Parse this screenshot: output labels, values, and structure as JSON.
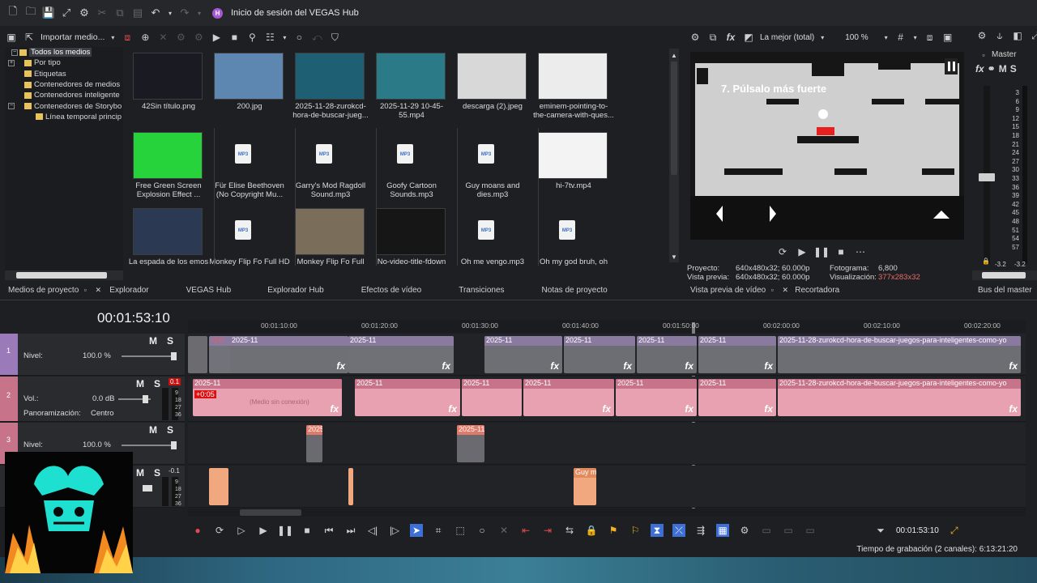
{
  "app": {
    "title": "Inicio de sesión del VEGAS Hub",
    "hub_badge": "H"
  },
  "media_toolbar": {
    "import_label": "Importar medio..."
  },
  "tree": {
    "items": [
      {
        "label": "Todos los medios",
        "selected": true
      },
      {
        "label": "Por tipo"
      },
      {
        "label": "Etiquetas"
      },
      {
        "label": "Contenedores de medios"
      },
      {
        "label": "Contenedores inteligente"
      },
      {
        "label": "Contenedores de Storybo"
      },
      {
        "label": "Línea temporal princip"
      }
    ]
  },
  "media": [
    {
      "label": "42Sin título.png",
      "kind": "image",
      "color": "#1a1a22"
    },
    {
      "label": "200.jpg",
      "kind": "image",
      "color": "#5d87b0"
    },
    {
      "label": "2025-11-28-zurokcd-hora-de-buscar-jueg...",
      "kind": "video",
      "color": "#1f5f73"
    },
    {
      "label": "2025-11-29 10-45-55.mp4",
      "kind": "video",
      "color": "#2a7a88"
    },
    {
      "label": "descarga (2).jpeg",
      "kind": "image",
      "color": "#d8d8d8"
    },
    {
      "label": "eminem-pointing-to-the-camera-with-ques...",
      "kind": "image",
      "color": "#ececec"
    },
    {
      "label": "Free Green Screen Explosion Effect ...",
      "kind": "image",
      "color": "#27d33a"
    },
    {
      "label": "Für Elise  Beethoven (No Copyright Mu...",
      "kind": "mp3"
    },
    {
      "label": "Garry's Mod Ragdoll Sound.mp3",
      "kind": "mp3"
    },
    {
      "label": "Goofy Cartoon Sounds.mp3",
      "kind": "mp3"
    },
    {
      "label": "Guy moans and dies.mp3",
      "kind": "mp3"
    },
    {
      "label": "hi-7tv.mp4",
      "kind": "image",
      "color": "#f3f3f3"
    },
    {
      "label": "La espada de los emos",
      "kind": "video",
      "color": "#2b3a52"
    },
    {
      "label": "Monkey Flip Fo Full HD",
      "kind": "mp3"
    },
    {
      "label": "Monkey Flip Fo Full",
      "kind": "image",
      "color": "#7a6e5a"
    },
    {
      "label": "No-video-title-fdown",
      "kind": "video",
      "color": "#161616"
    },
    {
      "label": "Oh me vengo.mp3",
      "kind": "mp3"
    },
    {
      "label": "Oh my god bruh, oh",
      "kind": "mp3"
    }
  ],
  "mp3_tag": "MP3",
  "tabs_left": [
    "Medios de proyecto",
    "Explorador",
    "VEGAS Hub",
    "Explorador Hub",
    "Efectos de vídeo",
    "Transiciones",
    "Notas de proyecto"
  ],
  "preview": {
    "quality": "La mejor (total)",
    "zoom": "100 %",
    "game_title": "7. Púlsalo más fuerte",
    "proyecto_label": "Proyecto:",
    "proyecto_value": "640x480x32; 60.000p",
    "vista_label": "Vista previa:",
    "vista_value": "640x480x32; 60.000p",
    "fotograma_label": "Fotograma:",
    "fotograma_value": "6,800",
    "visualizacion_label": "Visualización:",
    "visualizacion_value": "377x283x32",
    "tab_preview": "Vista previa de vídeo",
    "tab_trimmer": "Recortadora"
  },
  "master": {
    "label": "Master",
    "scale": [
      "3",
      "6",
      "9",
      "12",
      "15",
      "18",
      "21",
      "24",
      "27",
      "30",
      "33",
      "36",
      "39",
      "42",
      "45",
      "48",
      "51",
      "54",
      "57"
    ],
    "left_val": "-3.2",
    "right_val": "-3.2",
    "tab": "Bus del master"
  },
  "timeline": {
    "time": "00:01:53:10",
    "ruler": [
      "00:01:10:00",
      "00:01:20:00",
      "00:01:30:00",
      "00:01:40:00",
      "00:01:50:00",
      "00:02:00:00",
      "00:02:10:00",
      "00:02:20:00"
    ],
    "tracks": [
      {
        "num": "1",
        "type": "video",
        "level_label": "Nivel:",
        "level_value": "100.0 %",
        "m": "M",
        "s": "S"
      },
      {
        "num": "2",
        "type": "audio",
        "vol_label": "Vol.:",
        "vol_value": "0.0 dB",
        "pan_label": "Panoramización:",
        "pan_value": "Centro",
        "m": "M",
        "s": "S",
        "peak": "0.1"
      },
      {
        "num": "3",
        "type": "video",
        "level_label": "Nivel:",
        "level_value": "100.0 %",
        "m": "M",
        "s": "S"
      },
      {
        "num": "4",
        "type": "audio",
        "m": "M",
        "s": "S",
        "peak": "-0.1"
      }
    ],
    "meter_scale": [
      "9",
      "18",
      "27",
      "36"
    ],
    "clip_title_long": "2025-11-28-zurokcd-hora-de-buscar-juegos-para-inteligentes-como-yo",
    "clip_short": "2025-11",
    "clip_medio": "(Medio sin conexión)",
    "offset_video": "-0:0",
    "offset_audio": "+0:05",
    "fx": "fx",
    "guy_clip": "Guy m",
    "end_time": "00:01:53:10"
  },
  "status": {
    "record_time": "Tiempo de grabación (2 canales): 6:13:21:20"
  }
}
